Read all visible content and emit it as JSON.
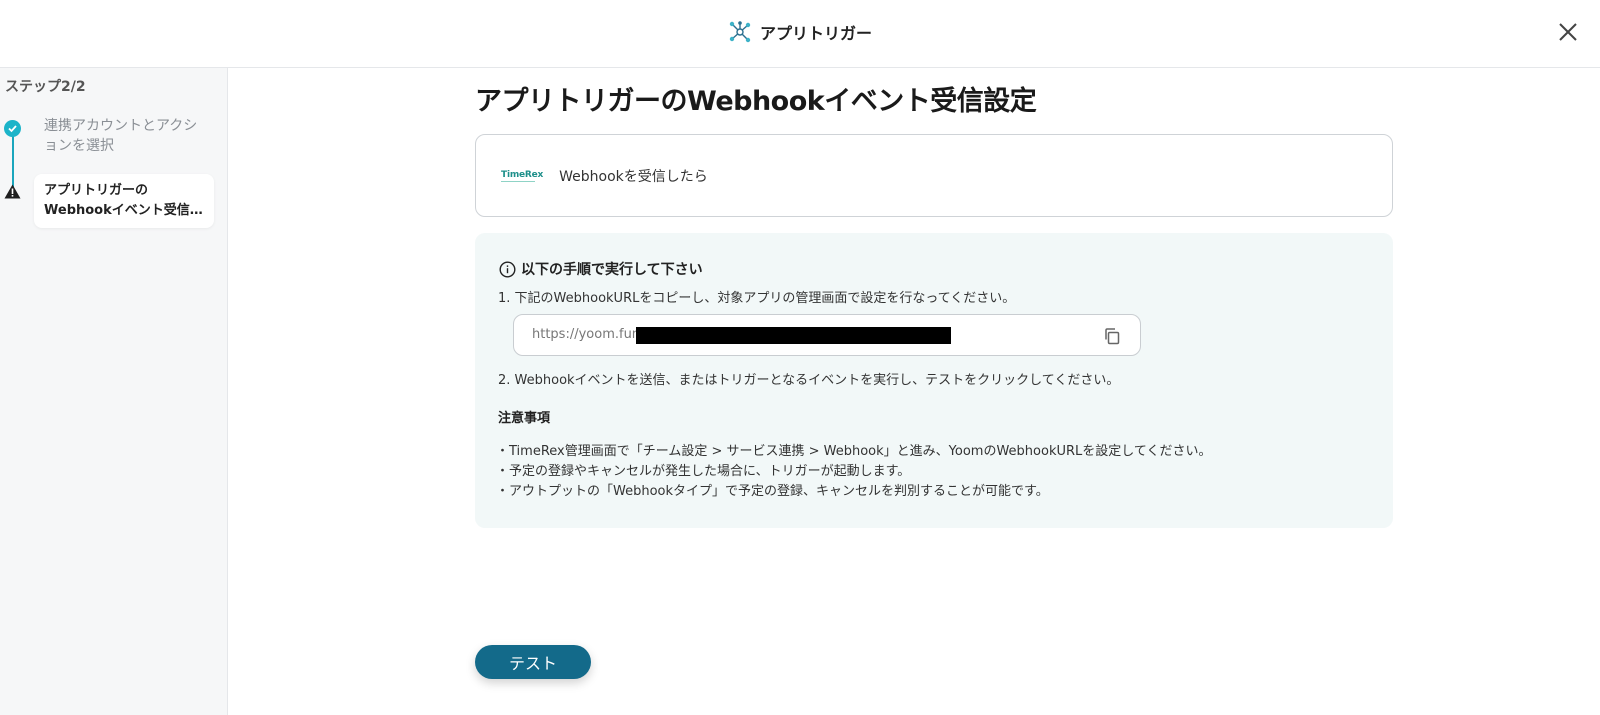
{
  "header": {
    "title": "アプリトリガー",
    "logo_icon": "network-nodes-icon",
    "close_icon": "close-icon"
  },
  "sidebar": {
    "step_count": "ステップ2/2",
    "steps": [
      {
        "label": "連携アカウントとアクションを選択",
        "status": "done"
      },
      {
        "label_line1": "アプリトリガーの",
        "label_line2": "Webhookイベント受信...",
        "status": "current-warning"
      }
    ]
  },
  "main": {
    "page_title": "アプリトリガーのWebhookイベント受信設定",
    "trigger": {
      "logo_text": "TimeRex",
      "label": "Webhookを受信したら"
    },
    "instructions": {
      "heading": "以下の手順で実行して下さい",
      "step1": "1. 下記のWebhookURLをコピーし、対象アプリの管理画面で設定を行なってください。",
      "url": "https://yoom.fun/",
      "step2": "2. Webhookイベントを送信、またはトリガーとなるイベントを実行し、テストをクリックしてください。",
      "notes_heading": "注意事項",
      "notes": [
        "・TimeRex管理画面で「チーム設定 > サービス連携 > Webhook」と進み、YoomのWebhookURLを設定してください。",
        "・予定の登録やキャンセルが発生した場合に、トリガーが起動します。",
        "・アウトプットの「Webhookタイプ」で予定の登録、キャンセルを判別することが可能です。"
      ]
    },
    "test_button": "テスト"
  },
  "colors": {
    "accent_teal": "#1cb4c9",
    "button_blue": "#136a8a",
    "instructions_bg": "#f2f8f8"
  }
}
